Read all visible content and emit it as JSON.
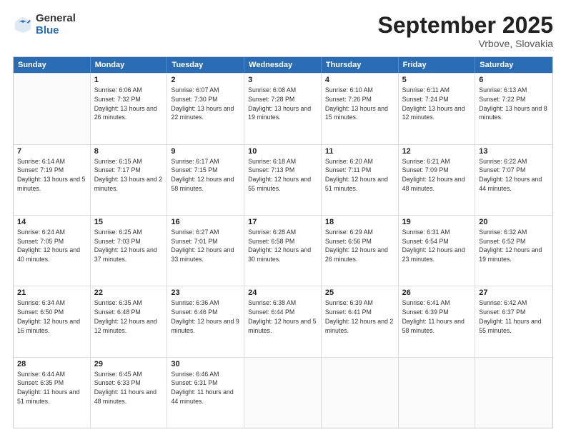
{
  "logo": {
    "general": "General",
    "blue": "Blue"
  },
  "title": {
    "month": "September 2025",
    "location": "Vrbove, Slovakia"
  },
  "header": {
    "days": [
      "Sunday",
      "Monday",
      "Tuesday",
      "Wednesday",
      "Thursday",
      "Friday",
      "Saturday"
    ]
  },
  "weeks": [
    [
      {
        "day": "",
        "empty": true
      },
      {
        "day": "1",
        "sunrise": "Sunrise: 6:06 AM",
        "sunset": "Sunset: 7:32 PM",
        "daylight": "Daylight: 13 hours and 26 minutes."
      },
      {
        "day": "2",
        "sunrise": "Sunrise: 6:07 AM",
        "sunset": "Sunset: 7:30 PM",
        "daylight": "Daylight: 13 hours and 22 minutes."
      },
      {
        "day": "3",
        "sunrise": "Sunrise: 6:08 AM",
        "sunset": "Sunset: 7:28 PM",
        "daylight": "Daylight: 13 hours and 19 minutes."
      },
      {
        "day": "4",
        "sunrise": "Sunrise: 6:10 AM",
        "sunset": "Sunset: 7:26 PM",
        "daylight": "Daylight: 13 hours and 15 minutes."
      },
      {
        "day": "5",
        "sunrise": "Sunrise: 6:11 AM",
        "sunset": "Sunset: 7:24 PM",
        "daylight": "Daylight: 13 hours and 12 minutes."
      },
      {
        "day": "6",
        "sunrise": "Sunrise: 6:13 AM",
        "sunset": "Sunset: 7:22 PM",
        "daylight": "Daylight: 13 hours and 8 minutes."
      }
    ],
    [
      {
        "day": "7",
        "sunrise": "Sunrise: 6:14 AM",
        "sunset": "Sunset: 7:19 PM",
        "daylight": "Daylight: 13 hours and 5 minutes."
      },
      {
        "day": "8",
        "sunrise": "Sunrise: 6:15 AM",
        "sunset": "Sunset: 7:17 PM",
        "daylight": "Daylight: 13 hours and 2 minutes."
      },
      {
        "day": "9",
        "sunrise": "Sunrise: 6:17 AM",
        "sunset": "Sunset: 7:15 PM",
        "daylight": "Daylight: 12 hours and 58 minutes."
      },
      {
        "day": "10",
        "sunrise": "Sunrise: 6:18 AM",
        "sunset": "Sunset: 7:13 PM",
        "daylight": "Daylight: 12 hours and 55 minutes."
      },
      {
        "day": "11",
        "sunrise": "Sunrise: 6:20 AM",
        "sunset": "Sunset: 7:11 PM",
        "daylight": "Daylight: 12 hours and 51 minutes."
      },
      {
        "day": "12",
        "sunrise": "Sunrise: 6:21 AM",
        "sunset": "Sunset: 7:09 PM",
        "daylight": "Daylight: 12 hours and 48 minutes."
      },
      {
        "day": "13",
        "sunrise": "Sunrise: 6:22 AM",
        "sunset": "Sunset: 7:07 PM",
        "daylight": "Daylight: 12 hours and 44 minutes."
      }
    ],
    [
      {
        "day": "14",
        "sunrise": "Sunrise: 6:24 AM",
        "sunset": "Sunset: 7:05 PM",
        "daylight": "Daylight: 12 hours and 40 minutes."
      },
      {
        "day": "15",
        "sunrise": "Sunrise: 6:25 AM",
        "sunset": "Sunset: 7:03 PM",
        "daylight": "Daylight: 12 hours and 37 minutes."
      },
      {
        "day": "16",
        "sunrise": "Sunrise: 6:27 AM",
        "sunset": "Sunset: 7:01 PM",
        "daylight": "Daylight: 12 hours and 33 minutes."
      },
      {
        "day": "17",
        "sunrise": "Sunrise: 6:28 AM",
        "sunset": "Sunset: 6:58 PM",
        "daylight": "Daylight: 12 hours and 30 minutes."
      },
      {
        "day": "18",
        "sunrise": "Sunrise: 6:29 AM",
        "sunset": "Sunset: 6:56 PM",
        "daylight": "Daylight: 12 hours and 26 minutes."
      },
      {
        "day": "19",
        "sunrise": "Sunrise: 6:31 AM",
        "sunset": "Sunset: 6:54 PM",
        "daylight": "Daylight: 12 hours and 23 minutes."
      },
      {
        "day": "20",
        "sunrise": "Sunrise: 6:32 AM",
        "sunset": "Sunset: 6:52 PM",
        "daylight": "Daylight: 12 hours and 19 minutes."
      }
    ],
    [
      {
        "day": "21",
        "sunrise": "Sunrise: 6:34 AM",
        "sunset": "Sunset: 6:50 PM",
        "daylight": "Daylight: 12 hours and 16 minutes."
      },
      {
        "day": "22",
        "sunrise": "Sunrise: 6:35 AM",
        "sunset": "Sunset: 6:48 PM",
        "daylight": "Daylight: 12 hours and 12 minutes."
      },
      {
        "day": "23",
        "sunrise": "Sunrise: 6:36 AM",
        "sunset": "Sunset: 6:46 PM",
        "daylight": "Daylight: 12 hours and 9 minutes."
      },
      {
        "day": "24",
        "sunrise": "Sunrise: 6:38 AM",
        "sunset": "Sunset: 6:44 PM",
        "daylight": "Daylight: 12 hours and 5 minutes."
      },
      {
        "day": "25",
        "sunrise": "Sunrise: 6:39 AM",
        "sunset": "Sunset: 6:41 PM",
        "daylight": "Daylight: 12 hours and 2 minutes."
      },
      {
        "day": "26",
        "sunrise": "Sunrise: 6:41 AM",
        "sunset": "Sunset: 6:39 PM",
        "daylight": "Daylight: 11 hours and 58 minutes."
      },
      {
        "day": "27",
        "sunrise": "Sunrise: 6:42 AM",
        "sunset": "Sunset: 6:37 PM",
        "daylight": "Daylight: 11 hours and 55 minutes."
      }
    ],
    [
      {
        "day": "28",
        "sunrise": "Sunrise: 6:44 AM",
        "sunset": "Sunset: 6:35 PM",
        "daylight": "Daylight: 11 hours and 51 minutes."
      },
      {
        "day": "29",
        "sunrise": "Sunrise: 6:45 AM",
        "sunset": "Sunset: 6:33 PM",
        "daylight": "Daylight: 11 hours and 48 minutes."
      },
      {
        "day": "30",
        "sunrise": "Sunrise: 6:46 AM",
        "sunset": "Sunset: 6:31 PM",
        "daylight": "Daylight: 11 hours and 44 minutes."
      },
      {
        "day": "",
        "empty": true
      },
      {
        "day": "",
        "empty": true
      },
      {
        "day": "",
        "empty": true
      },
      {
        "day": "",
        "empty": true
      }
    ]
  ]
}
